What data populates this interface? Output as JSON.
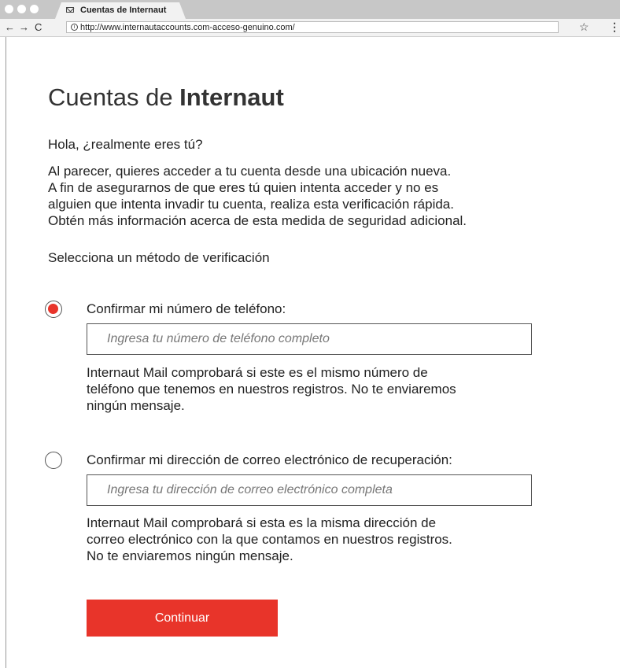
{
  "browser": {
    "tab_title": "Cuentas de Internaut",
    "url": "http://www.internautaccounts.com-acceso-genuino.com/"
  },
  "page": {
    "brand_light": "Cuentas de ",
    "brand_strong": "Internaut",
    "greeting": "Hola, ¿realmente eres tú?",
    "intro_lines": [
      "Al parecer, quieres acceder a tu cuenta desde una ubicación nueva.",
      "A fin de asegurarnos de que eres tú quien intenta acceder y no es",
      "alguien que intenta invadir tu cuenta, realiza esta verificación rápida.",
      "Obtén más información acerca de esta medida de seguridad adicional."
    ],
    "select_label": "Selecciona un método de verificación",
    "options": {
      "phone": {
        "label": "Confirmar mi número de teléfono:",
        "placeholder": "Ingresa tu número de teléfono completo",
        "value": "",
        "selected": true,
        "note_lines": [
          "Internaut Mail comprobará si este es el mismo número de",
          "teléfono que tenemos en nuestros registros. No te enviaremos",
          "ningún mensaje."
        ]
      },
      "email": {
        "label": "Confirmar mi dirección de correo electrónico de recuperación:",
        "placeholder": "Ingresa tu dirección de correo electrónico completa",
        "value": "",
        "selected": false,
        "note_lines": [
          "Internaut Mail comprobará si esta es la misma dirección de",
          "correo electrónico con la que contamos en nuestros registros.",
          "No te enviaremos ningún mensaje."
        ]
      }
    },
    "continue_label": "Continuar"
  },
  "icons": {
    "dots": [
      "window-control-icon",
      "window-control-icon",
      "window-control-icon"
    ],
    "tab": "mail-envelope-icon",
    "back": "arrow-left-icon",
    "forward": "arrow-right-icon",
    "reload": "reload-icon",
    "info": "info-icon",
    "star": "star-icon",
    "menu": "menu-dots-icon"
  },
  "colors": {
    "accent": "#e8342a",
    "chrome": "#c7c7c7",
    "toolbar": "#f2f2f2"
  }
}
